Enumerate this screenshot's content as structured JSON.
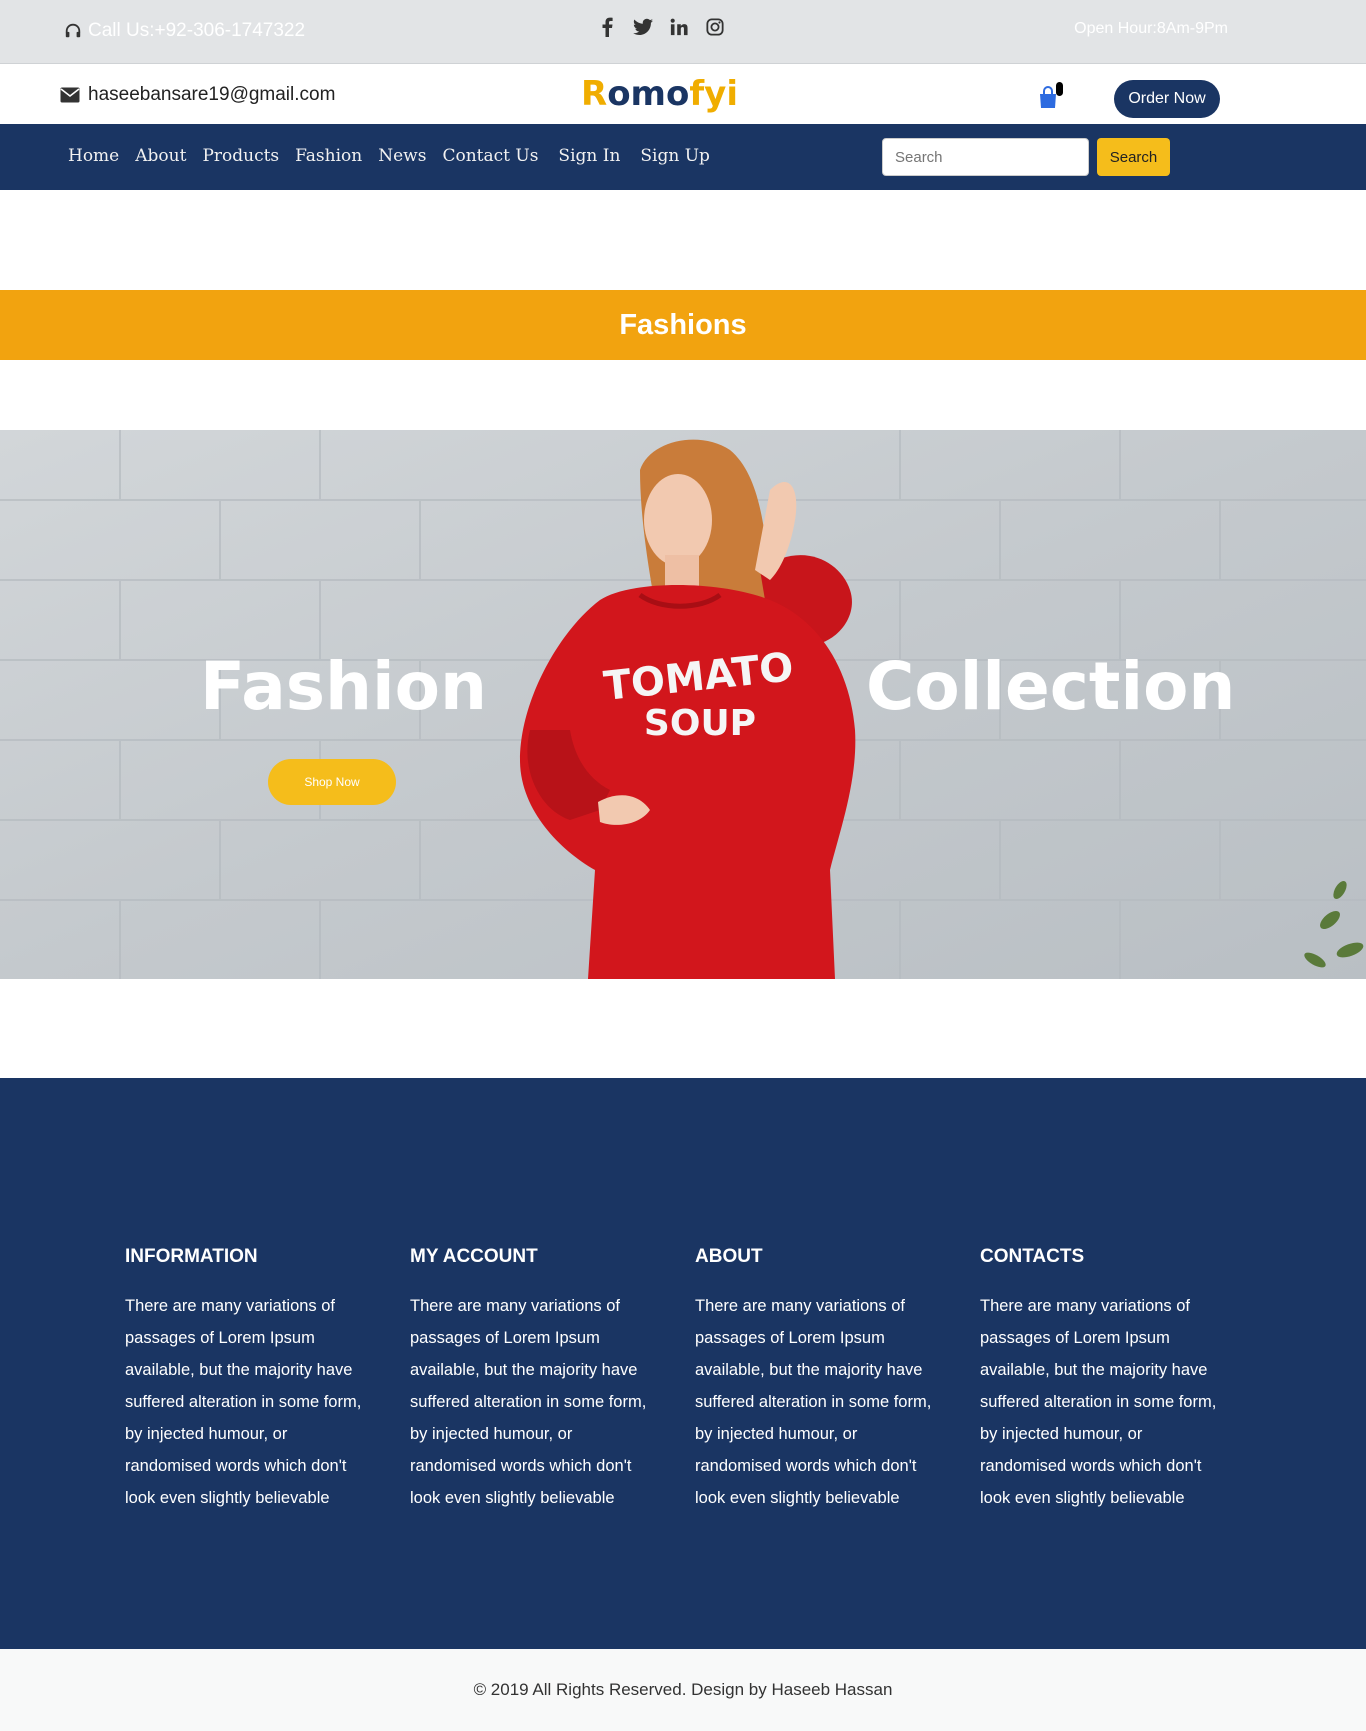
{
  "topbar": {
    "call": "Call Us:+92-306-1747322",
    "hours": "Open Hour:8Am-9Pm",
    "social_icons": [
      "facebook-icon",
      "twitter-icon",
      "linkedin-icon",
      "instagram-icon"
    ]
  },
  "header": {
    "email": "haseebansare19@gmail.com",
    "logo": "Romofyi",
    "order_button": "Order Now"
  },
  "nav": {
    "items": [
      "Home",
      "About",
      "Products",
      "Fashion",
      "News",
      "Contact Us",
      "Sign In",
      "Sign Up"
    ],
    "search_placeholder": "Search",
    "search_button": "Search"
  },
  "banner": {
    "title": "Fashions"
  },
  "hero": {
    "left_title": "Fashion",
    "right_title": "Collection",
    "shirt_text_line1": "TOMATO",
    "shirt_text_line2": "SOUP",
    "shop_button": "Shop Now"
  },
  "footer": {
    "columns": [
      {
        "heading": "INFORMATION",
        "text": "There are many variations of passages of Lorem Ipsum available, but the majority have suffered alteration in some form, by injected humour, or randomised words which don't look even slightly believable"
      },
      {
        "heading": "MY ACCOUNT",
        "text": "There are many variations of passages of Lorem Ipsum available, but the majority have suffered alteration in some form, by injected humour, or randomised words which don't look even slightly believable"
      },
      {
        "heading": "ABOUT",
        "text": "There are many variations of passages of Lorem Ipsum available, but the majority have suffered alteration in some form, by injected humour, or randomised words which don't look even slightly believable"
      },
      {
        "heading": "CONTACTS",
        "text": "There are many variations of passages of Lorem Ipsum available, but the majority have suffered alteration in some form, by injected humour, or randomised words which don't look even slightly believable"
      }
    ],
    "copyright": "© 2019 All Rights Reserved. Design by Haseeb Hassan"
  },
  "colors": {
    "navy": "#1a3563",
    "accent_yellow": "#f5bd1b",
    "banner_orange": "#f2a30f"
  }
}
